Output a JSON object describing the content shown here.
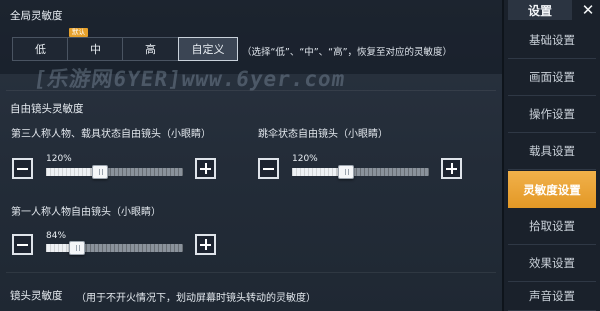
{
  "global": {
    "title": "全局灵敏度",
    "options": [
      "低",
      "中",
      "高",
      "自定义"
    ],
    "default_badge": "默认",
    "selected": "自定义",
    "hint": "（选择“低”、“中”、“高”，恢复至对应的灵敏度）"
  },
  "watermark": "[乐游网6YER]www.6yer.com",
  "free_look": {
    "title": "自由镜头灵敏度",
    "slider_tpp": {
      "label": "第三人称人物、载具状态自由镜头（小眼睛）",
      "value_text": "120%",
      "value": 120
    },
    "slider_parachute": {
      "label": "跳伞状态自由镜头（小眼睛）",
      "value_text": "120%",
      "value": 120
    },
    "slider_fpp": {
      "label": "第一人称人物自由镜头（小眼睛）",
      "value_text": "84%",
      "value": 84
    }
  },
  "camera": {
    "title": "镜头灵敏度",
    "hint": "（用于不开火情况下，划动屏幕时镜头转动的灵敏度）"
  },
  "sidebar": {
    "title": "设置",
    "close_icon": "close-icon",
    "items": [
      {
        "label": "基础设置"
      },
      {
        "label": "画面设置"
      },
      {
        "label": "操作设置"
      },
      {
        "label": "载具设置"
      },
      {
        "label": "灵敏度设置"
      },
      {
        "label": "拾取设置"
      },
      {
        "label": "效果设置"
      },
      {
        "label": "声音设置"
      }
    ],
    "active": "灵敏度设置"
  },
  "colors": {
    "accent": "#e8a030",
    "panel_bg": "#232c38",
    "sidebar_bg": "#1a212b"
  }
}
